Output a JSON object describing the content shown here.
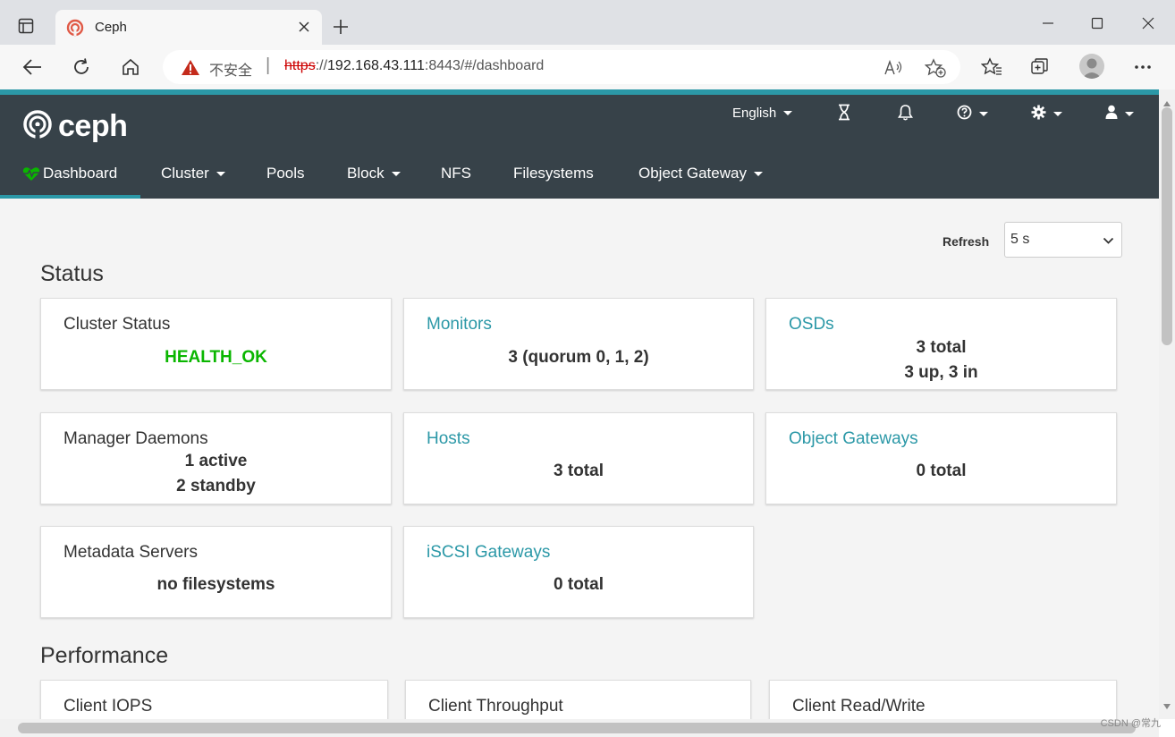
{
  "browser": {
    "tab_title": "Ceph",
    "security_text": "不安全",
    "url_scheme": "https",
    "url_sep": "://",
    "url_host": "192.168.43.111",
    "url_rest": ":8443/#/dashboard"
  },
  "topnav": {
    "logo_text": "ceph",
    "language": "English",
    "menu": [
      {
        "label": "Dashboard",
        "active": true
      },
      {
        "label": "Cluster",
        "dropdown": true
      },
      {
        "label": "Pools"
      },
      {
        "label": "Block",
        "dropdown": true
      },
      {
        "label": "NFS"
      },
      {
        "label": "Filesystems"
      },
      {
        "label": "Object Gateway",
        "dropdown": true
      }
    ]
  },
  "refresh": {
    "label": "Refresh",
    "value": "5 s"
  },
  "status": {
    "title": "Status",
    "cards": [
      {
        "title": "Cluster Status",
        "values": [
          "HEALTH_OK"
        ]
      },
      {
        "title": "Monitors",
        "values": [
          "3 (quorum 0, 1, 2)"
        ]
      },
      {
        "title": "OSDs",
        "values": [
          "3 total",
          "3 up, 3 in"
        ]
      },
      {
        "title": "Manager Daemons",
        "values": [
          "1 active",
          "2 standby"
        ]
      },
      {
        "title": "Hosts",
        "values": [
          "3 total"
        ]
      },
      {
        "title": "Object Gateways",
        "values": [
          "0 total"
        ]
      },
      {
        "title": "Metadata Servers",
        "values": [
          "no filesystems"
        ]
      },
      {
        "title": "iSCSI Gateways",
        "values": [
          "0 total"
        ]
      }
    ]
  },
  "performance": {
    "title": "Performance",
    "cards": [
      {
        "title": "Client IOPS"
      },
      {
        "title": "Client Throughput"
      },
      {
        "title": "Client Read/Write"
      }
    ]
  },
  "watermark": "CSDN @常九",
  "colors": {
    "nav_bg": "#374249",
    "accent": "#2b98a7",
    "health_ok": "#0ab600",
    "link": "#2b98a7"
  }
}
